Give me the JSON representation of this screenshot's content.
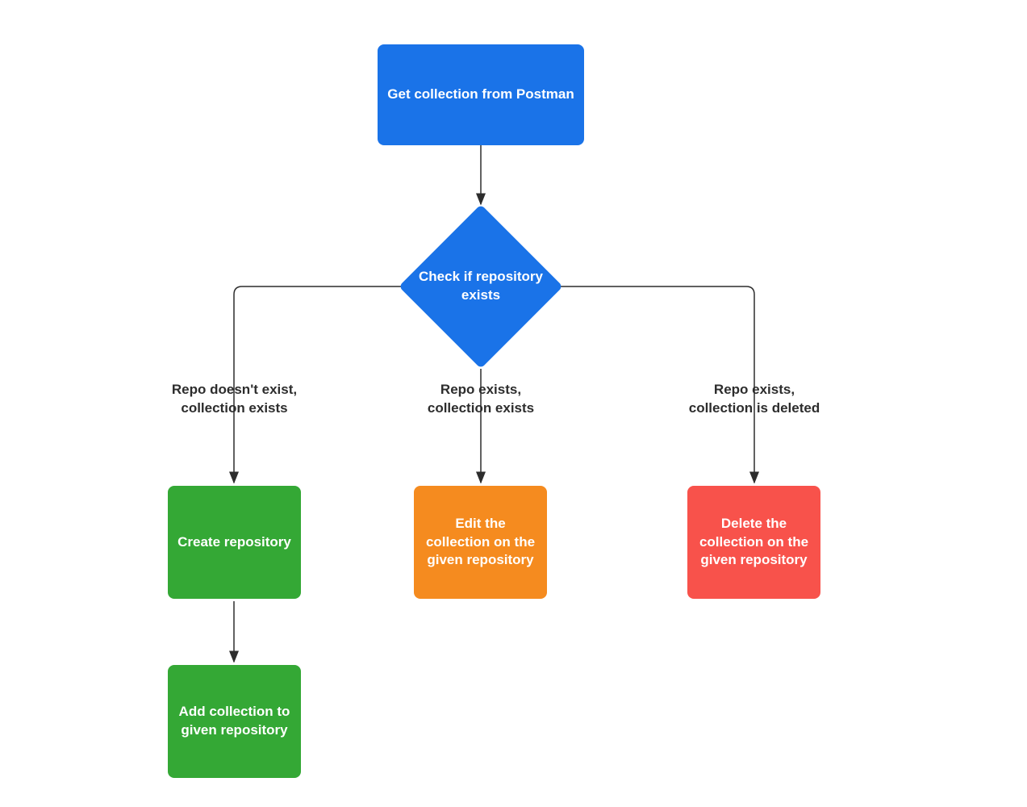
{
  "nodes": {
    "start": {
      "label": "Get collection from Postman"
    },
    "decision": {
      "label": "Check if repository exists"
    },
    "create_repo": {
      "label": "Create repository"
    },
    "add_collection": {
      "label": "Add collection to given repository"
    },
    "edit_collection": {
      "label": "Edit the collection on the given repository"
    },
    "delete_collection": {
      "label": "Delete the collection on the given repository"
    }
  },
  "edges": {
    "left": {
      "label": "Repo doesn't exist,\ncollection exists"
    },
    "middle": {
      "label": "Repo exists,\ncollection exists"
    },
    "right": {
      "label": "Repo exists,\ncollection is deleted"
    }
  },
  "colors": {
    "blue": "#1a73e8",
    "green": "#34a835",
    "orange": "#f58b1f",
    "red": "#f8524b",
    "text": "#2d2d2d"
  }
}
